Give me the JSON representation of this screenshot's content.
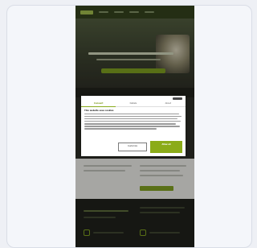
{
  "consent_dialog": {
    "tabs": [
      {
        "label": "Consent"
      },
      {
        "label": "Details"
      },
      {
        "label": "About"
      }
    ],
    "title": "This website uses cookies",
    "customize_label": "Customize",
    "allow_all_label": "Allow all"
  },
  "colors": {
    "accent": "#8bab18",
    "nav_background": "#33411c",
    "footer_background": "#1f211b"
  }
}
